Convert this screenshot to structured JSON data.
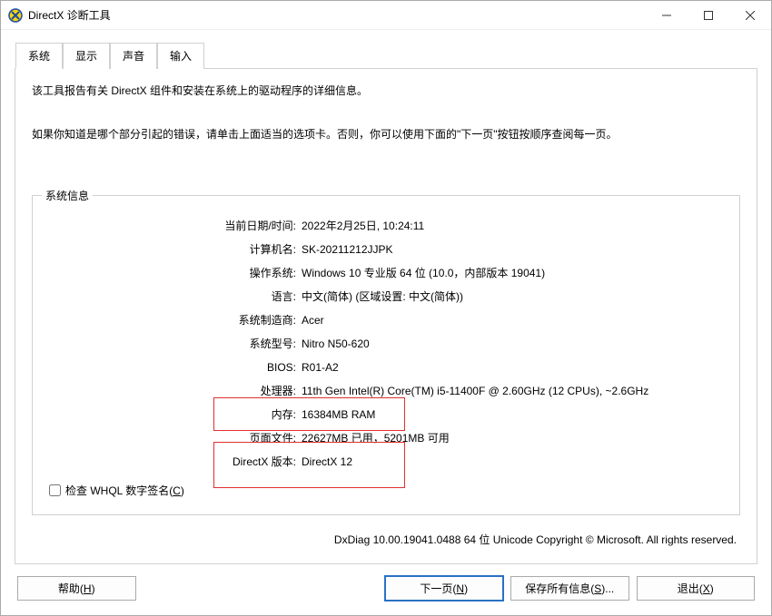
{
  "window": {
    "title": "DirectX 诊断工具"
  },
  "tabs": [
    "系统",
    "显示",
    "声音",
    "输入"
  ],
  "intro": {
    "line1": "该工具报告有关 DirectX 组件和安装在系统上的驱动程序的详细信息。",
    "line2": "如果你知道是哪个部分引起的错误，请单击上面适当的选项卡。否则，你可以使用下面的\"下一页\"按钮按顺序查阅每一页。"
  },
  "group_title": "系统信息",
  "rows": [
    {
      "label": "当前日期/时间:",
      "value": "2022年2月25日, 10:24:11"
    },
    {
      "label": "计算机名:",
      "value": "SK-20211212JJPK"
    },
    {
      "label": "操作系统:",
      "value": "Windows 10 专业版 64 位 (10.0，内部版本 19041)"
    },
    {
      "label": "语言:",
      "value": "中文(简体) (区域设置: 中文(简体))"
    },
    {
      "label": "系统制造商:",
      "value": "Acer"
    },
    {
      "label": "系统型号:",
      "value": "Nitro N50-620"
    },
    {
      "label": "BIOS:",
      "value": "R01-A2"
    },
    {
      "label": "处理器:",
      "value": "11th Gen Intel(R) Core(TM) i5-11400F @ 2.60GHz (12 CPUs), ~2.6GHz"
    },
    {
      "label": "内存:",
      "value": "16384MB RAM"
    },
    {
      "label": "页面文件:",
      "value": "22627MB 已用，5201MB 可用"
    },
    {
      "label": "DirectX 版本:",
      "value": "DirectX 12"
    }
  ],
  "whql_label_pre": "检查 WHQL 数字签名(",
  "whql_label_key": "C",
  "whql_label_post": ")",
  "copyright": "DxDiag 10.00.19041.0488 64 位 Unicode  Copyright © Microsoft. All rights reserved.",
  "buttons": {
    "help_pre": "帮助(",
    "help_key": "H",
    "help_post": ")",
    "next_pre": "下一页(",
    "next_key": "N",
    "next_post": ")",
    "save_pre": "保存所有信息(",
    "save_key": "S",
    "save_post": ")...",
    "exit_pre": "退出(",
    "exit_key": "X",
    "exit_post": ")"
  }
}
